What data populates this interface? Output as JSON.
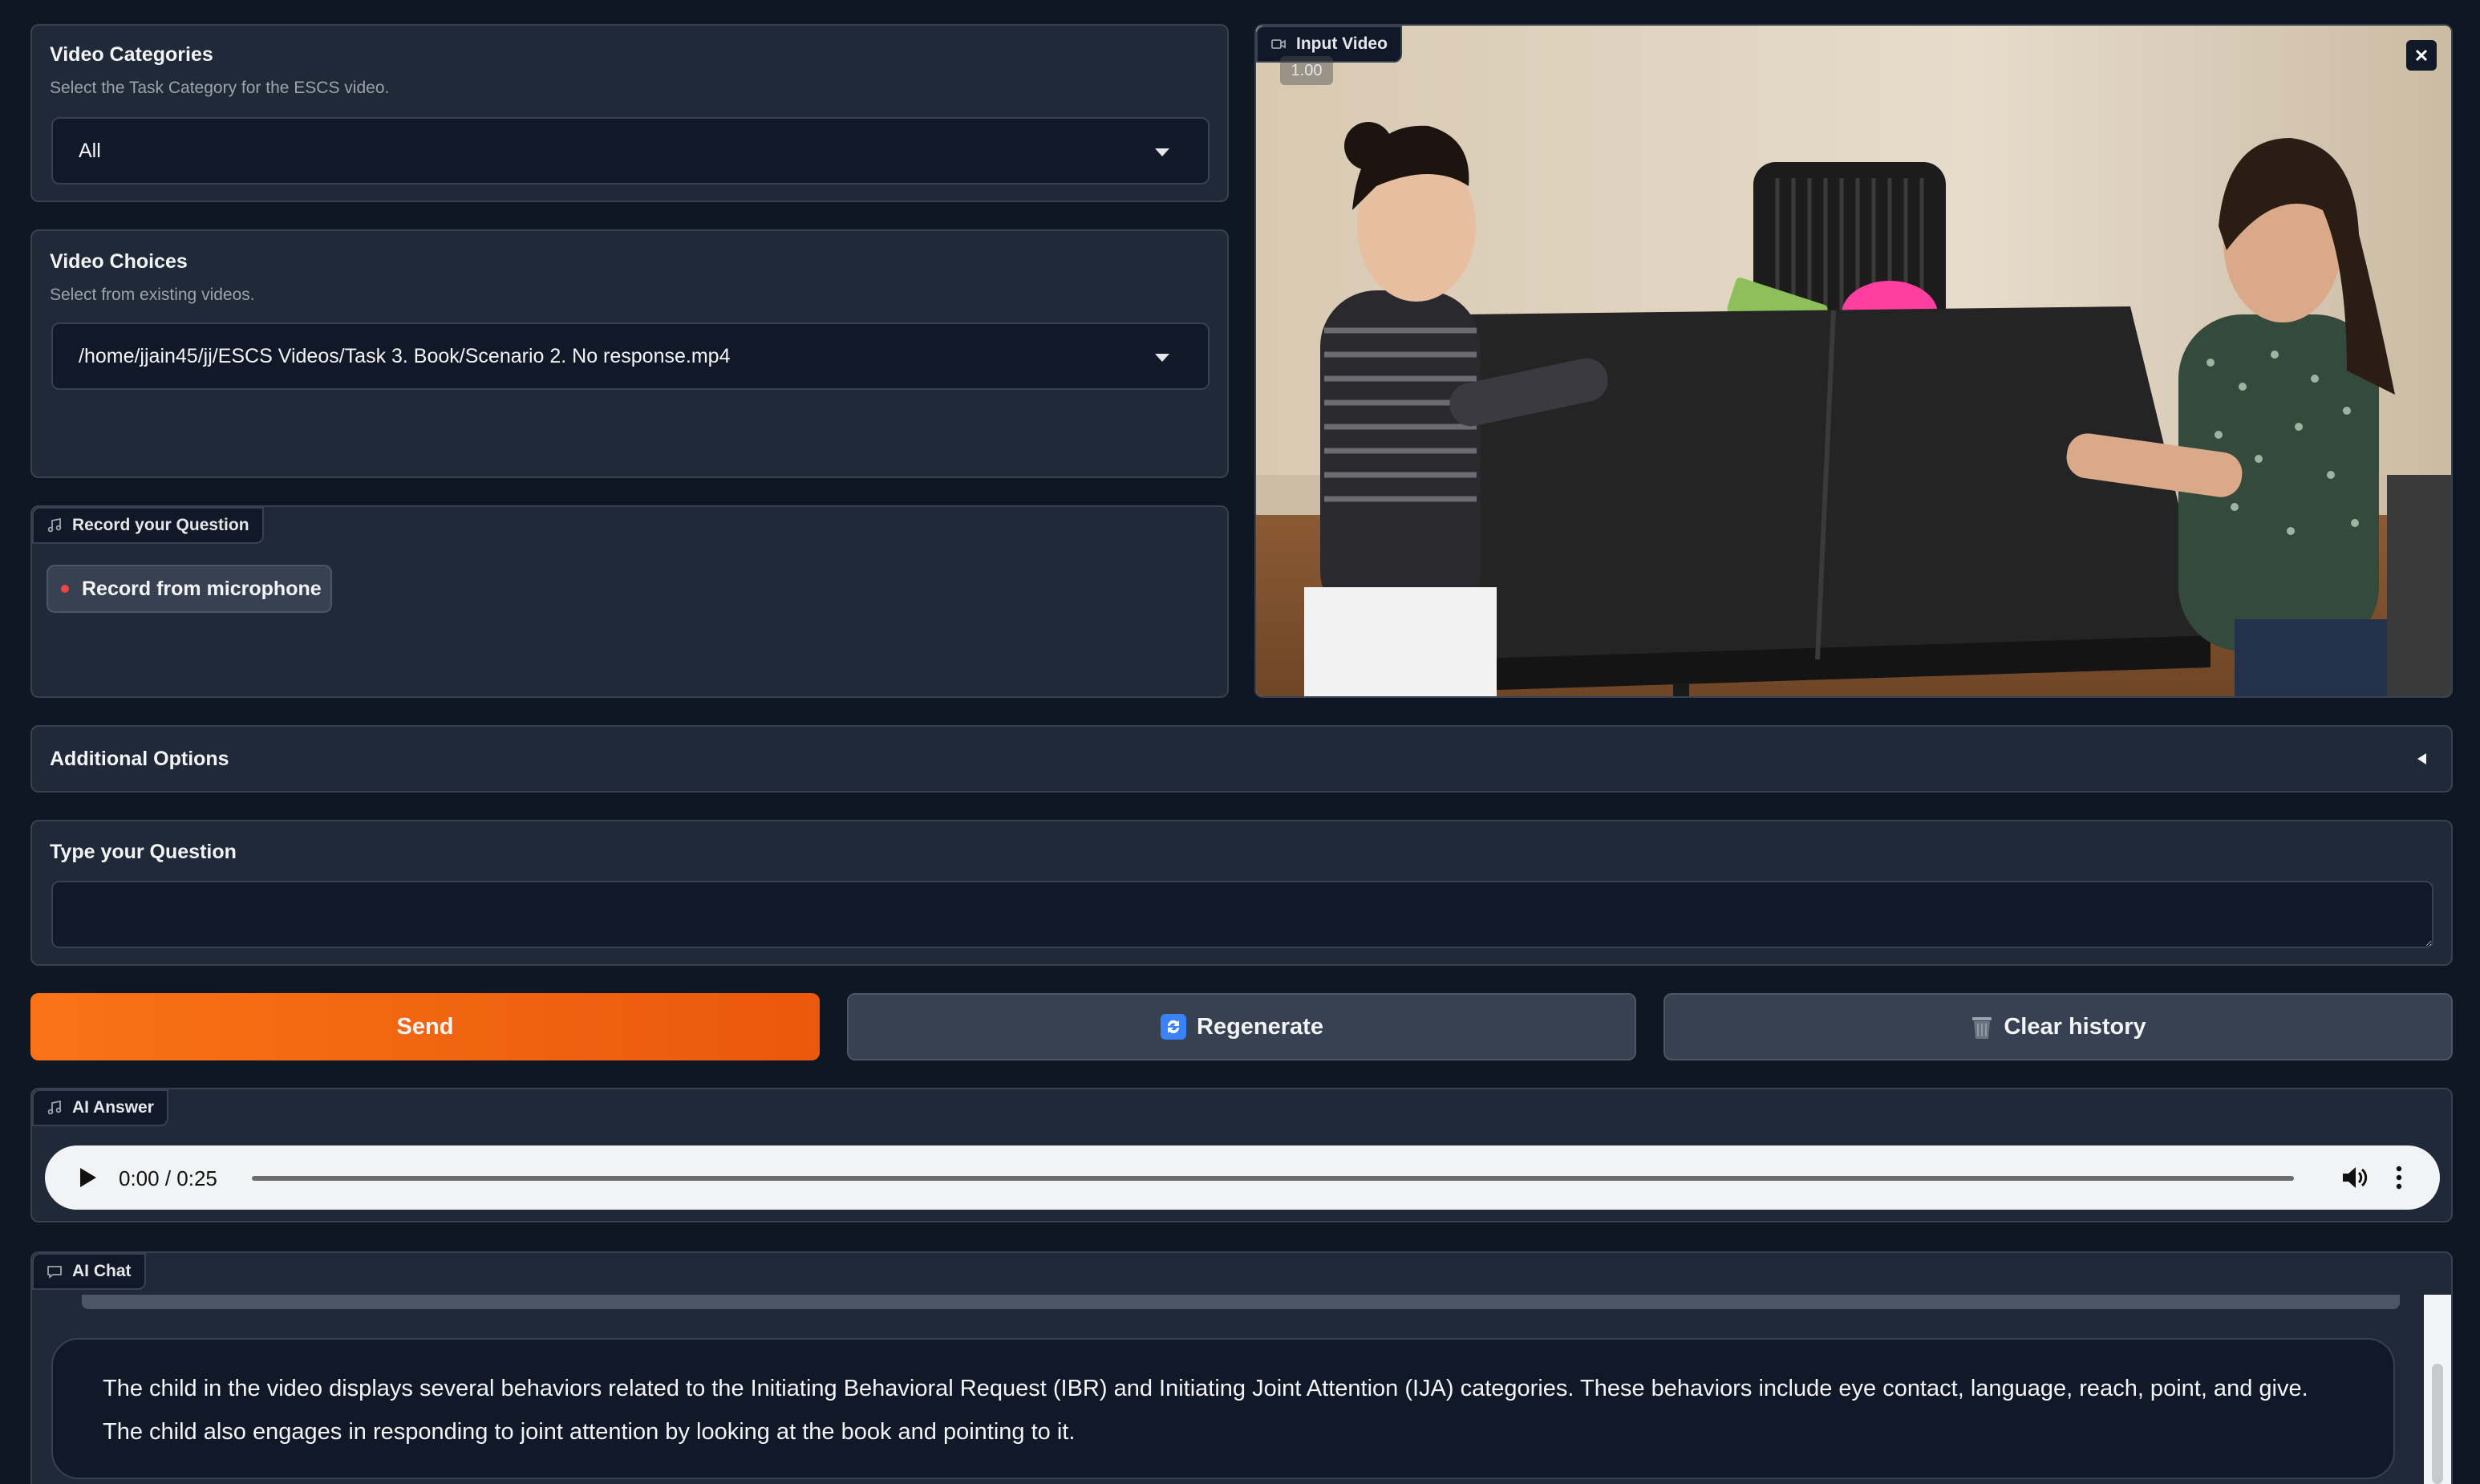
{
  "video_categories": {
    "title": "Video Categories",
    "subtitle": "Select the Task Category for the ESCS video.",
    "selected": "All"
  },
  "video_choices": {
    "title": "Video Choices",
    "subtitle": "Select from existing videos.",
    "selected": "/home/jjain45/jj/ESCS Videos/Task 3. Book/Scenario 2. No response.mp4"
  },
  "record": {
    "tag_label": "Record your Question",
    "button_label": "Record from microphone"
  },
  "input_video": {
    "tag_label": "Input Video",
    "playback_rate": "1.00"
  },
  "additional_options": {
    "label": "Additional Options"
  },
  "question": {
    "label": "Type your Question",
    "value": ""
  },
  "actions": {
    "send_label": "Send",
    "regenerate_label": "Regenerate",
    "clear_label": "Clear history"
  },
  "ai_answer": {
    "tag_label": "AI Answer",
    "time": "0:00 / 0:25",
    "progress": 0
  },
  "ai_chat": {
    "tag_label": "AI Chat",
    "message": "The child in the video displays several behaviors related to the Initiating Behavioral Request (IBR) and Initiating Joint Attention (IJA) categories. These behaviors include eye contact, language, reach, point, and give. The child also engages in responding to joint attention by looking at the book and pointing to it."
  },
  "colors": {
    "accent": "#f97316",
    "panel": "#1f2937",
    "background": "#0f1624",
    "record_dot": "#ef4444"
  }
}
